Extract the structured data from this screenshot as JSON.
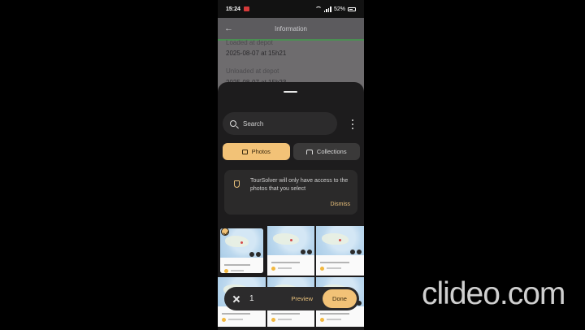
{
  "status_bar": {
    "time": "15:24",
    "battery": "52%"
  },
  "app": {
    "header_title": "Information",
    "fields": [
      {
        "label": "Loaded at depot",
        "value": "2025-08-07 at 15h21"
      },
      {
        "label": "Unloaded at depot",
        "value": "2025-08-07 at 15h23"
      }
    ]
  },
  "picker": {
    "search_placeholder": "Search",
    "tabs": [
      {
        "label": "Photos",
        "icon": "image-icon",
        "active": true
      },
      {
        "label": "Collections",
        "icon": "collections-icon",
        "active": false
      }
    ],
    "notice": {
      "text": "TourSolver will only have access to the photos that you select",
      "dismiss": "Dismiss"
    },
    "photo_count": 6,
    "selected_count": "1",
    "preview_label": "Preview",
    "done_label": "Done"
  },
  "watermark": "clideo.com",
  "colors": {
    "accent": "#f2c277",
    "sheet_bg": "#1d1c1d",
    "app_green": "#4a8f52"
  }
}
